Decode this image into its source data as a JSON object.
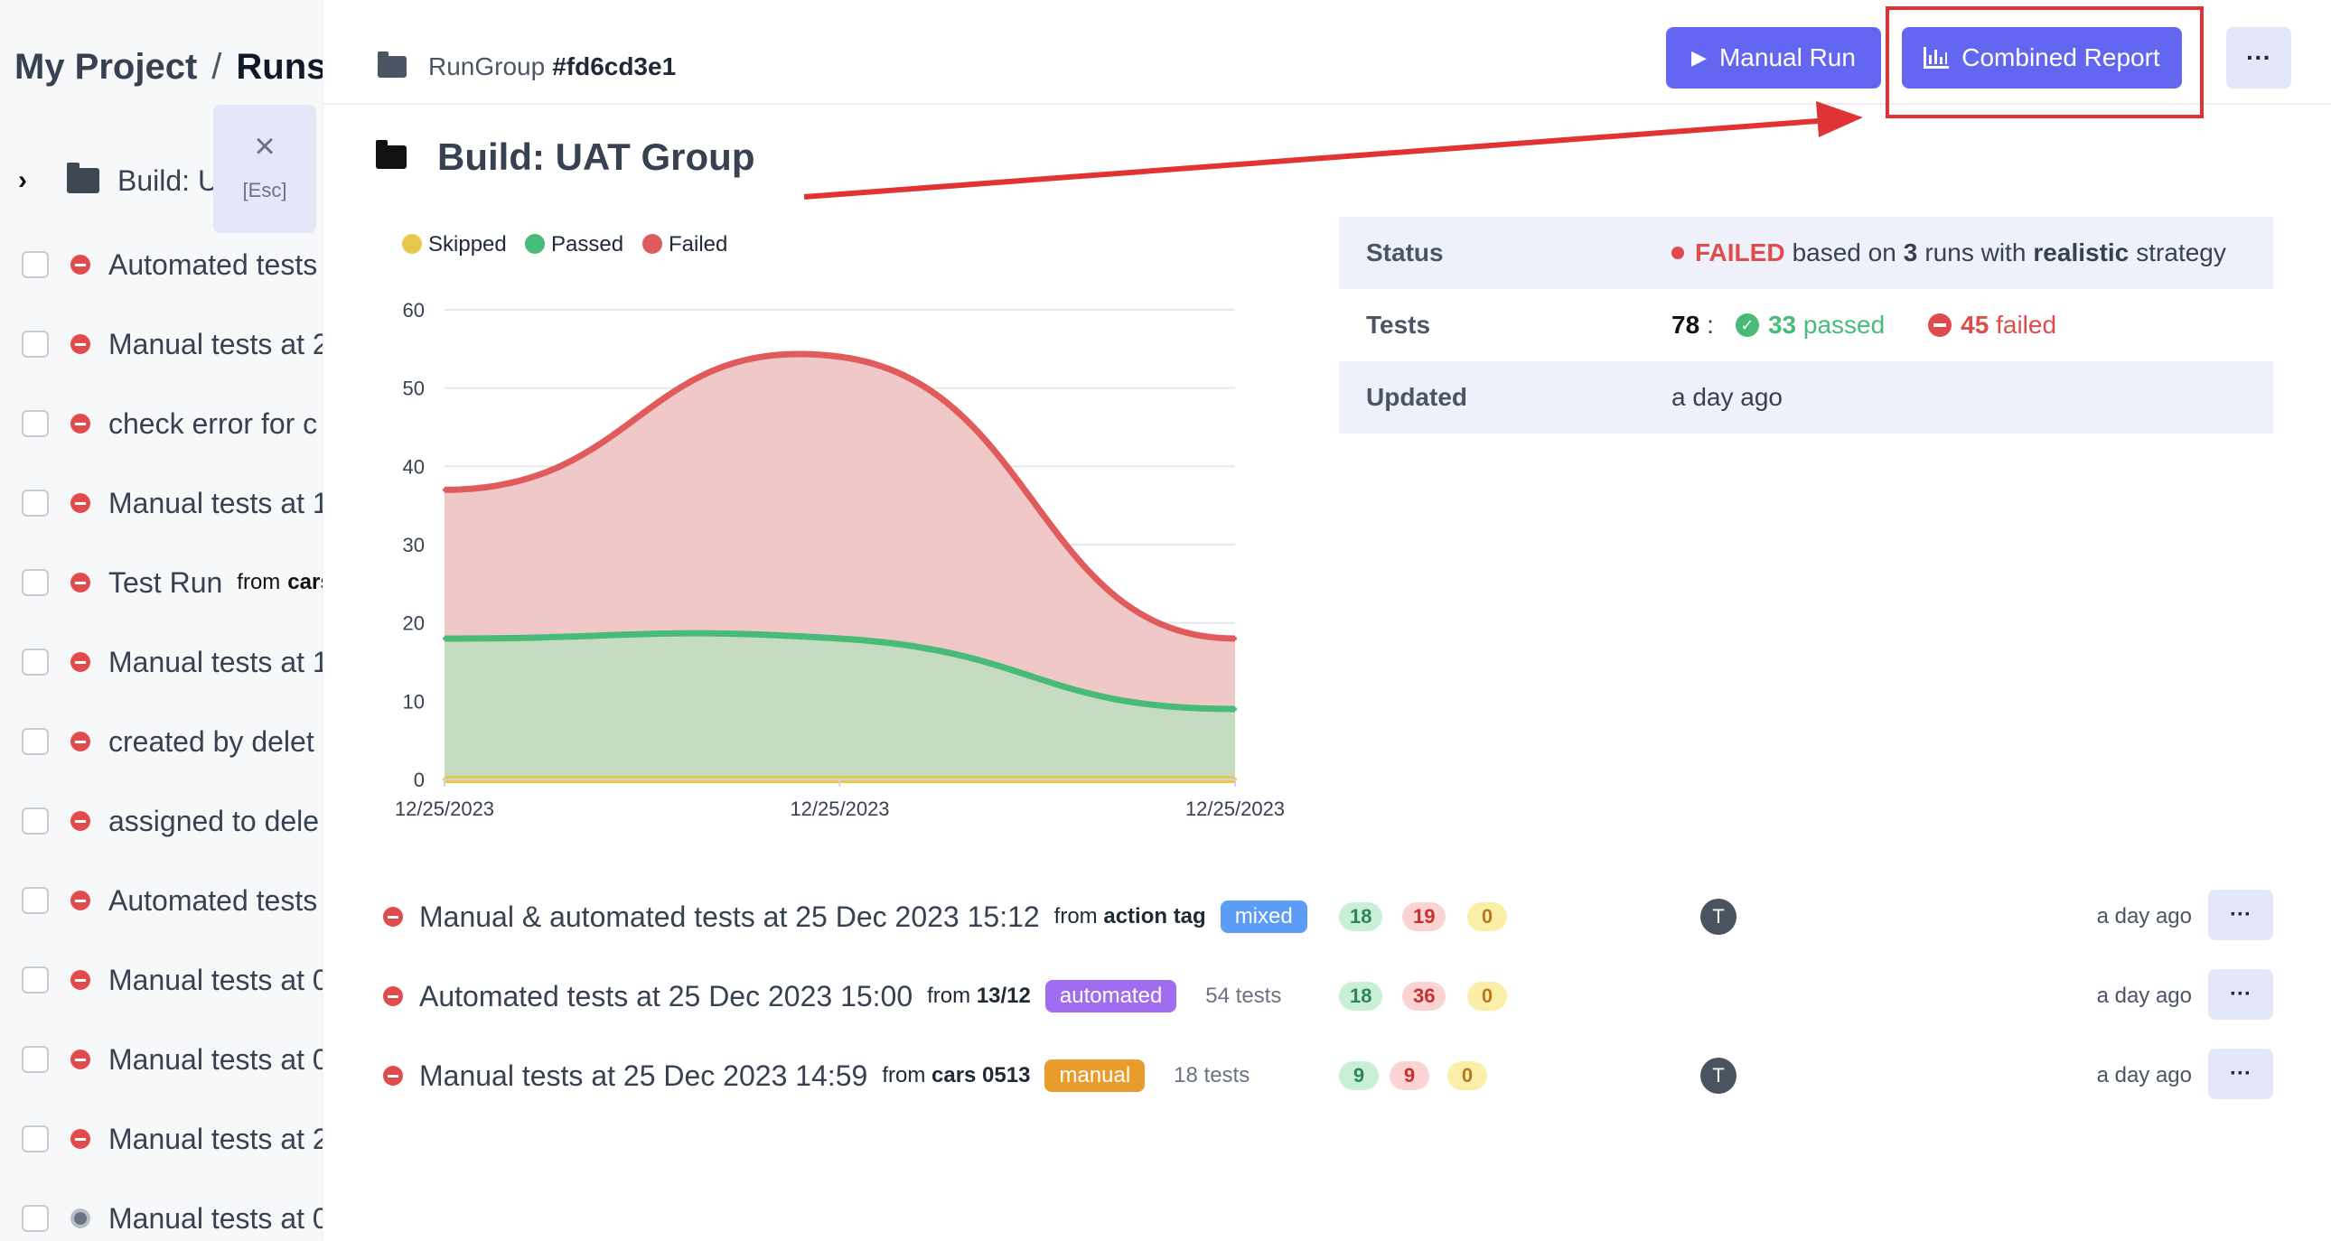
{
  "breadcrumb": {
    "project": "My Project",
    "separator": "/",
    "section": "Runs"
  },
  "sidebar": {
    "group_label": "Build: U",
    "esc_hint": "[Esc]",
    "items": [
      {
        "label": "Automated tests",
        "status": "failed"
      },
      {
        "label": "Manual tests at 2",
        "status": "failed"
      },
      {
        "label": "check error for c",
        "status": "failed"
      },
      {
        "label": "Manual tests at 1",
        "status": "failed"
      },
      {
        "label": "Test Run",
        "from": "from",
        "from_value": "cars",
        "status": "failed"
      },
      {
        "label": "Manual tests at 1",
        "status": "failed"
      },
      {
        "label": "created by delet",
        "status": "failed"
      },
      {
        "label": "assigned to dele",
        "status": "failed"
      },
      {
        "label": "Automated tests",
        "status": "failed"
      },
      {
        "label": "Manual tests at 0",
        "status": "failed"
      },
      {
        "label": "Manual tests at 0",
        "status": "failed"
      },
      {
        "label": "Manual tests at 2",
        "status": "failed"
      },
      {
        "label": "Manual tests at 0",
        "status": "in-progress"
      }
    ]
  },
  "header": {
    "rungroup_label": "RunGroup",
    "rungroup_id": "#fd6cd3e1",
    "manual_run_label": "Manual Run",
    "combined_report_label": "Combined Report",
    "more_label": "···"
  },
  "group_title": "Build: UAT Group",
  "colors": {
    "accent": "#6366f1",
    "passed": "#48bb78",
    "failed": "#e04b4b",
    "skipped": "#e8c84a",
    "annotation": "#e03434"
  },
  "chart_data": {
    "type": "area",
    "title": "",
    "xlabel": "",
    "ylabel": "",
    "legend": [
      "Skipped",
      "Passed",
      "Failed"
    ],
    "legend_position": "top-left",
    "x": [
      "12/25/2023",
      "12/25/2023",
      "12/25/2023"
    ],
    "ylim": [
      0,
      60
    ],
    "yticks": [
      0,
      10,
      20,
      30,
      40,
      50,
      60
    ],
    "grid": true,
    "stacked": true,
    "series": [
      {
        "name": "Skipped",
        "values": [
          0,
          0,
          0
        ],
        "color": "#e8c84a"
      },
      {
        "name": "Passed",
        "values": [
          18,
          18,
          9
        ],
        "color": "#48bb78"
      },
      {
        "name": "Failed",
        "values": [
          19,
          36,
          9
        ],
        "color": "#e05c5c"
      }
    ]
  },
  "status_panel": {
    "status_key": "Status",
    "status_failed": "FAILED",
    "status_text_1": "based on",
    "status_runs": "3",
    "status_text_2": "runs with",
    "status_strategy": "realistic",
    "status_text_3": "strategy",
    "tests_key": "Tests",
    "tests_total": "78",
    "tests_colon": ":",
    "tests_passed": "33",
    "tests_passed_word": "passed",
    "tests_failed": "45",
    "tests_failed_word": "failed",
    "updated_key": "Updated",
    "updated_value": "a day ago"
  },
  "runs": [
    {
      "name": "Manual & automated tests at 25 Dec 2023 15:12",
      "from": "from",
      "from_value": "action tag",
      "tag": "mixed",
      "tests": "",
      "passed": "18",
      "failed": "19",
      "skipped": "0",
      "avatar": "T",
      "ago": "a day ago",
      "more": "···"
    },
    {
      "name": "Automated tests at 25 Dec 2023 15:00",
      "from": "from",
      "from_value": "13/12",
      "tag": "automated",
      "tests": "54 tests",
      "passed": "18",
      "failed": "36",
      "skipped": "0",
      "avatar": "",
      "ago": "a day ago",
      "more": "···"
    },
    {
      "name": "Manual tests at 25 Dec 2023 14:59",
      "from": "from",
      "from_value": "cars 0513",
      "tag": "manual",
      "tests": "18 tests",
      "passed": "9",
      "failed": "9",
      "skipped": "0",
      "avatar": "T",
      "ago": "a day ago",
      "more": "···"
    }
  ]
}
